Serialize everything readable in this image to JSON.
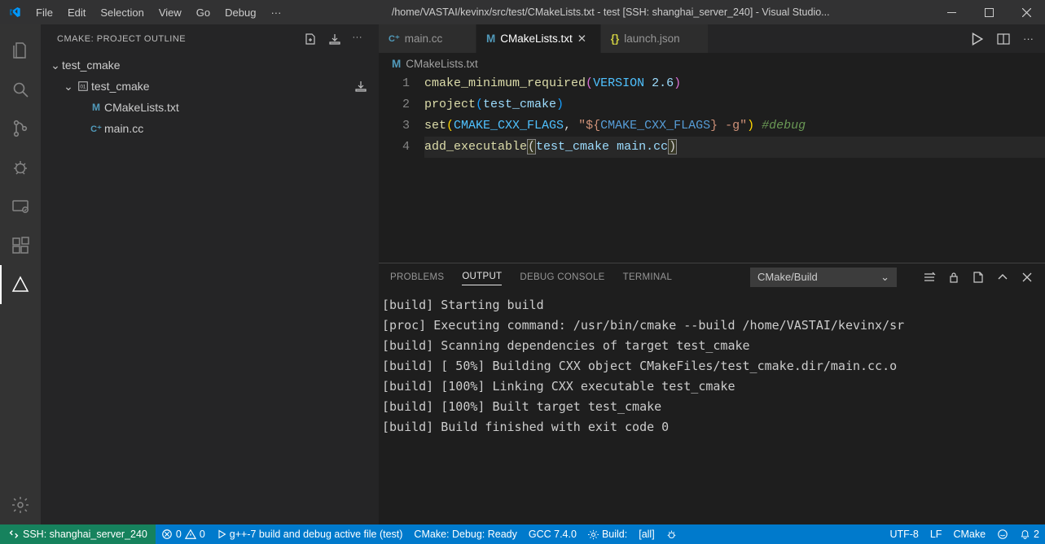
{
  "menubar": {
    "items": [
      "File",
      "Edit",
      "Selection",
      "View",
      "Go",
      "Debug"
    ]
  },
  "window_title": "/home/VASTAI/kevinx/src/test/CMakeLists.txt - test [SSH: shanghai_server_240] - Visual Studio...",
  "sidebar": {
    "title": "CMAKE: PROJECT OUTLINE",
    "tree": {
      "root": "test_cmake",
      "target": "test_cmake",
      "files": [
        "CMakeLists.txt",
        "main.cc"
      ]
    }
  },
  "tabs": [
    {
      "label": "main.cc",
      "icon": "cpp",
      "active": false
    },
    {
      "label": "CMakeLists.txt",
      "icon": "cmake",
      "active": true
    },
    {
      "label": "launch.json",
      "icon": "json",
      "active": false
    }
  ],
  "breadcrumb": {
    "file": "CMakeLists.txt"
  },
  "editor": {
    "lines": [
      {
        "n": "1",
        "tok": [
          [
            "func",
            "cmake_minimum_required"
          ],
          [
            "paren",
            "("
          ],
          [
            "const",
            "VERSION"
          ],
          [
            "plain",
            " "
          ],
          [
            "ident",
            "2.6"
          ],
          [
            "paren",
            ")"
          ]
        ]
      },
      {
        "n": "2",
        "tok": [
          [
            "func",
            "project"
          ],
          [
            "paren-blue",
            "("
          ],
          [
            "ident",
            "test_cmake"
          ],
          [
            "paren-blue",
            ")"
          ]
        ]
      },
      {
        "n": "3",
        "tok": [
          [
            "func",
            "set"
          ],
          [
            "paren-yellow",
            "("
          ],
          [
            "const",
            "CMAKE_CXX_FLAGS"
          ],
          [
            "plain",
            ", "
          ],
          [
            "str",
            "\"${"
          ],
          [
            "var",
            "CMAKE_CXX_FLAGS"
          ],
          [
            "str",
            "} -g\""
          ],
          [
            "paren-yellow",
            ")"
          ],
          [
            "plain",
            " "
          ],
          [
            "comment",
            "#debug"
          ]
        ]
      },
      {
        "n": "4",
        "current": true,
        "tok": [
          [
            "func",
            "add_executable"
          ],
          [
            "match",
            "("
          ],
          [
            "ident",
            "test_cmake"
          ],
          [
            "plain",
            " "
          ],
          [
            "ident",
            "main.cc"
          ],
          [
            "match",
            ")"
          ]
        ]
      }
    ]
  },
  "panel": {
    "tabs": [
      "PROBLEMS",
      "OUTPUT",
      "DEBUG CONSOLE",
      "TERMINAL"
    ],
    "active_tab": "OUTPUT",
    "select": "CMake/Build",
    "output": [
      "[build] Starting build",
      "[proc] Executing command: /usr/bin/cmake --build /home/VASTAI/kevinx/sr",
      "[build] Scanning dependencies of target test_cmake",
      "[build] [ 50%] Building CXX object CMakeFiles/test_cmake.dir/main.cc.o",
      "[build] [100%] Linking CXX executable test_cmake",
      "[build] [100%] Built target test_cmake",
      "[build] Build finished with exit code 0"
    ]
  },
  "statusbar": {
    "remote": "SSH: shanghai_server_240",
    "errors": "0",
    "warnings": "0",
    "run_task": "g++-7 build and debug active file (test)",
    "cmake_status": "CMake: Debug: Ready",
    "gcc": "GCC 7.4.0",
    "build": "Build:",
    "target": "[all]",
    "encoding": "UTF-8",
    "eol": "LF",
    "language": "CMake",
    "notifications": "2"
  }
}
